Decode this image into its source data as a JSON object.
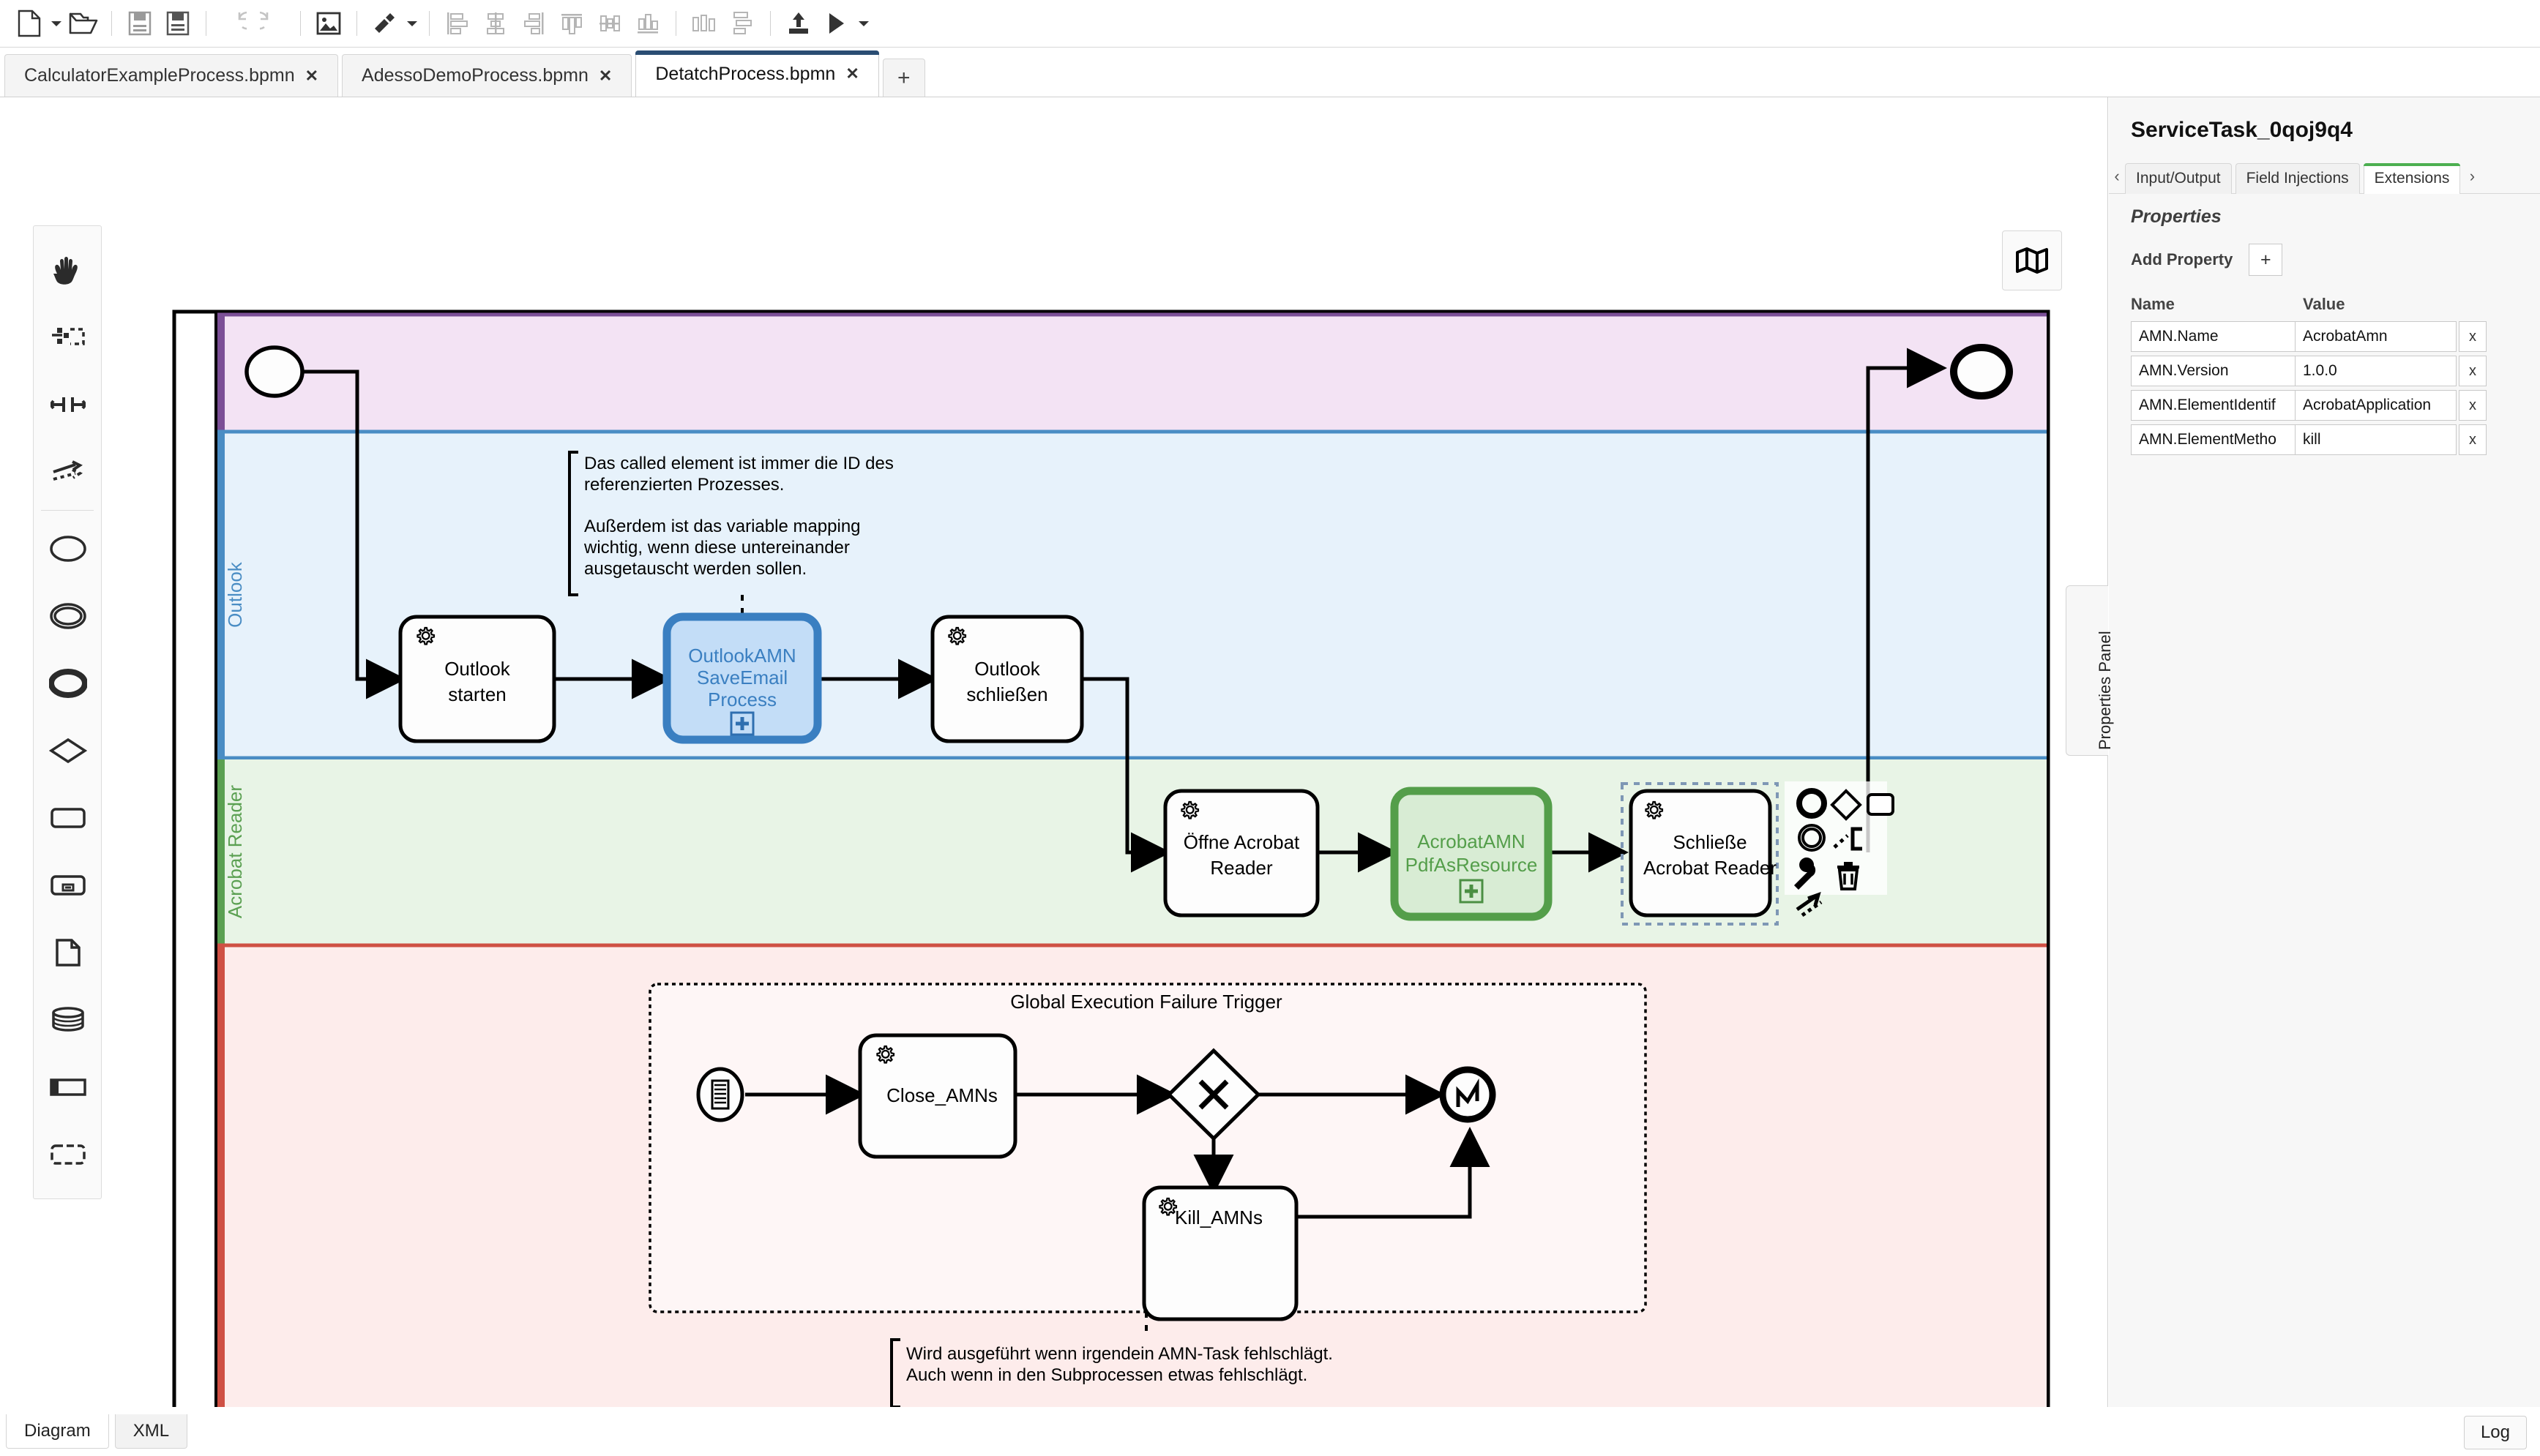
{
  "toolbar": {
    "items": [
      {
        "name": "new-file-icon",
        "label": "New"
      },
      {
        "name": "new-file-dropdown-caret",
        "label": "New options"
      },
      {
        "name": "open-folder-icon",
        "label": "Open"
      },
      {
        "name": "save-icon",
        "label": "Save"
      },
      {
        "name": "save-as-icon",
        "label": "Save As"
      },
      {
        "name": "undo-icon",
        "label": "Undo"
      },
      {
        "name": "redo-icon",
        "label": "Redo"
      },
      {
        "name": "export-image-icon",
        "label": "Export image"
      },
      {
        "name": "color-brush-icon",
        "label": "Set color"
      },
      {
        "name": "color-brush-dropdown-caret",
        "label": "Color options"
      },
      {
        "name": "align-left-icon",
        "label": "Align left"
      },
      {
        "name": "align-center-horizontal-icon",
        "label": "Align center"
      },
      {
        "name": "align-right-icon",
        "label": "Align right"
      },
      {
        "name": "align-top-icon",
        "label": "Align top"
      },
      {
        "name": "align-middle-icon",
        "label": "Align middle"
      },
      {
        "name": "align-bottom-icon",
        "label": "Align bottom"
      },
      {
        "name": "distribute-horizontal-icon",
        "label": "Distribute horizontally"
      },
      {
        "name": "distribute-vertical-icon",
        "label": "Distribute vertically"
      },
      {
        "name": "deploy-icon",
        "label": "Deploy"
      },
      {
        "name": "run-icon",
        "label": "Run"
      },
      {
        "name": "run-dropdown-caret",
        "label": "Run options"
      }
    ]
  },
  "tabs": {
    "items": [
      {
        "label": "CalculatorExampleProcess.bpmn",
        "close": "✕",
        "active": false
      },
      {
        "label": "AdessoDemoProcess.bpmn",
        "close": "✕",
        "active": false
      },
      {
        "label": "DetatchProcess.bpmn",
        "close": "✕",
        "active": true
      }
    ],
    "add_label": "+"
  },
  "palette": {
    "items": [
      {
        "name": "hand-tool-icon",
        "label": "Activate hand tool"
      },
      {
        "name": "lasso-tool-icon",
        "label": "Activate lasso tool"
      },
      {
        "name": "space-tool-icon",
        "label": "Activate space tool"
      },
      {
        "name": "global-connect-tool-icon",
        "label": "Activate global connect tool"
      },
      {
        "name": "start-event-icon",
        "label": "Create StartEvent"
      },
      {
        "name": "intermediate-event-icon",
        "label": "Create Intermediate/Boundary Event"
      },
      {
        "name": "end-event-icon",
        "label": "Create EndEvent"
      },
      {
        "name": "gateway-icon",
        "label": "Create Gateway"
      },
      {
        "name": "task-icon",
        "label": "Create Task"
      },
      {
        "name": "subprocess-icon",
        "label": "Create expanded SubProcess"
      },
      {
        "name": "data-object-icon",
        "label": "Create DataObjectReference"
      },
      {
        "name": "data-store-icon",
        "label": "Create DataStoreReference"
      },
      {
        "name": "participant-icon",
        "label": "Create Pool/Participant"
      },
      {
        "name": "group-icon",
        "label": "Create Group"
      }
    ]
  },
  "canvas": {
    "minimap_icon": "map-icon",
    "lanes": [
      {
        "name": "lane-unnamed",
        "label": "",
        "fill": "#f3e3f4",
        "stroke": "#7b4f96"
      },
      {
        "name": "lane-outlook",
        "label": "Outlook",
        "fill": "#e7f2fb",
        "stroke": "#4a8dc4"
      },
      {
        "name": "lane-acrobat-reader",
        "label": "Acrobat Reader",
        "fill": "#e8f4e6",
        "stroke": "#5ba052"
      },
      {
        "name": "lane-failure",
        "label": "",
        "fill": "#fdeceb",
        "stroke": "#cf5044"
      }
    ],
    "nodes": {
      "start_event": "",
      "end_event": "",
      "outlook_starten": "Outlook\nstarten",
      "outlook_amn_saveemail": "OutlookAMN\nSaveEmail\nProcess",
      "outlook_schliessen": "Outlook\nschließen",
      "oeffne_acrobat": "Öffne Acrobat\nReader",
      "acrobat_amn_pdf": "AcrobatAMN\nPdfAsResource",
      "schliesse_acrobat": "Schließe\nAcrobat Reader",
      "subprocess_title": "Global Execution Failure Trigger",
      "close_amns": "Close_AMNs",
      "kill_amns": "Kill_AMNs"
    },
    "annotations": {
      "note_called_element": "Das called element ist immer die ID des referenzierten Prozesses.\n\nAußerdem ist das variable mapping wichtig, wenn diese untereinander ausgetauscht werden sollen.",
      "note_failure": "Wird ausgeführt wenn irgendein AMN-Task fehlschlägt.\nAuch wenn in den Subprocessen etwas fehlschlägt."
    },
    "context_pad": [
      {
        "name": "append-end-event-icon"
      },
      {
        "name": "append-gateway-icon"
      },
      {
        "name": "append-task-icon"
      },
      {
        "name": "append-intermediate-event-icon"
      },
      {
        "name": "append-text-annotation-icon"
      },
      {
        "name": "change-type-wrench-icon"
      },
      {
        "name": "delete-trash-icon"
      },
      {
        "name": "connect-icon"
      }
    ],
    "colors": {
      "selected_stroke": "#3a7fc1",
      "selected_fill": "#c3ddf7",
      "green_stroke": "#549e4a",
      "green_fill": "#d8ecd4"
    }
  },
  "properties": {
    "title": "ServiceTask_0qoj9q4",
    "prev_arrow": "‹",
    "next_arrow": "›",
    "tabs": [
      {
        "label": "Input/Output",
        "active": false
      },
      {
        "label": "Field Injections",
        "active": false
      },
      {
        "label": "Extensions",
        "active": true
      }
    ],
    "section_label": "Properties",
    "add_property_label": "Add Property",
    "add_property_button": "+",
    "col_name": "Name",
    "col_value": "Value",
    "rows": [
      {
        "name": "AMN.Name",
        "value": "AcrobatAmn",
        "remove": "x"
      },
      {
        "name": "AMN.Version",
        "value": "1.0.0",
        "remove": "x"
      },
      {
        "name": "AMN.ElementIdentif",
        "value": "AcrobatApplication",
        "remove": "x"
      },
      {
        "name": "AMN.ElementMetho",
        "value": "kill",
        "remove": "x"
      }
    ],
    "panel_toggle_label": "Properties Panel"
  },
  "bottom": {
    "tabs": [
      {
        "label": "Diagram",
        "active": true
      },
      {
        "label": "XML",
        "active": false
      }
    ],
    "log_label": "Log"
  }
}
